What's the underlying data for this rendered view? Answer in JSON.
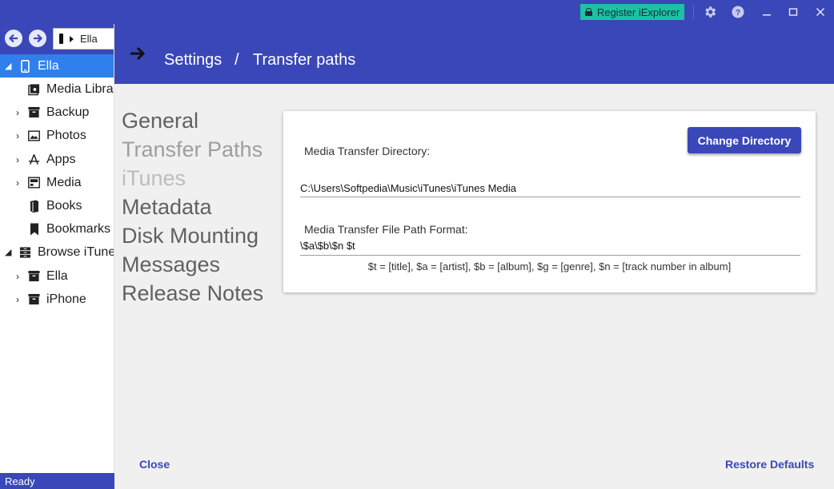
{
  "titlebar": {
    "register_label": "Register iExplorer",
    "icons": [
      "lock-icon",
      "gear-icon",
      "help-icon",
      "minimize-icon",
      "maximize-icon",
      "close-icon"
    ]
  },
  "sidebar": {
    "path_label": "Ella",
    "tree": [
      {
        "label": "Ella",
        "icon": "phone-icon",
        "selected": true
      },
      {
        "label": "Media Library",
        "icon": "media-library-icon"
      },
      {
        "label": "Backup",
        "icon": "archive-icon"
      },
      {
        "label": "Photos",
        "icon": "photo-icon"
      },
      {
        "label": "Apps",
        "icon": "apps-icon"
      },
      {
        "label": "Media",
        "icon": "media-icon"
      },
      {
        "label": "Books",
        "icon": "book-icon"
      },
      {
        "label": "Bookmarks",
        "icon": "bookmark-icon"
      },
      {
        "label": "Browse iTunes Backups",
        "icon": "backups-icon"
      },
      {
        "label": "Ella",
        "icon": "archive-icon"
      },
      {
        "label": "iPhone",
        "icon": "archive-icon"
      }
    ]
  },
  "status": {
    "text": "Ready"
  },
  "dialog": {
    "breadcrumb": {
      "root": "Settings",
      "separator": "/",
      "page": "Transfer paths"
    },
    "menu": [
      {
        "label": "General",
        "state": "normal"
      },
      {
        "label": "Transfer Paths",
        "state": "active"
      },
      {
        "label": "iTunes",
        "state": "disabled"
      },
      {
        "label": "Metadata",
        "state": "normal"
      },
      {
        "label": "Disk Mounting",
        "state": "normal"
      },
      {
        "label": "Messages",
        "state": "normal"
      },
      {
        "label": "Release Notes",
        "state": "normal"
      }
    ],
    "card": {
      "directory_label": "Media Transfer Directory:",
      "directory_value": "C:\\Users\\Softpedia\\Music\\iTunes\\iTunes Media",
      "change_button": "Change Directory",
      "format_label": "Media Transfer File Path Format:",
      "format_value": "\\$a\\$b\\$n $t",
      "format_help": "$t = [title], $a = [artist], $b = [album], $g = [genre], $n = [track number in album]"
    },
    "close_label": "Close",
    "restore_label": "Restore Defaults"
  },
  "colors": {
    "accent": "#3a47b8",
    "register": "#1bc3a3",
    "selection": "#2f80ed"
  }
}
